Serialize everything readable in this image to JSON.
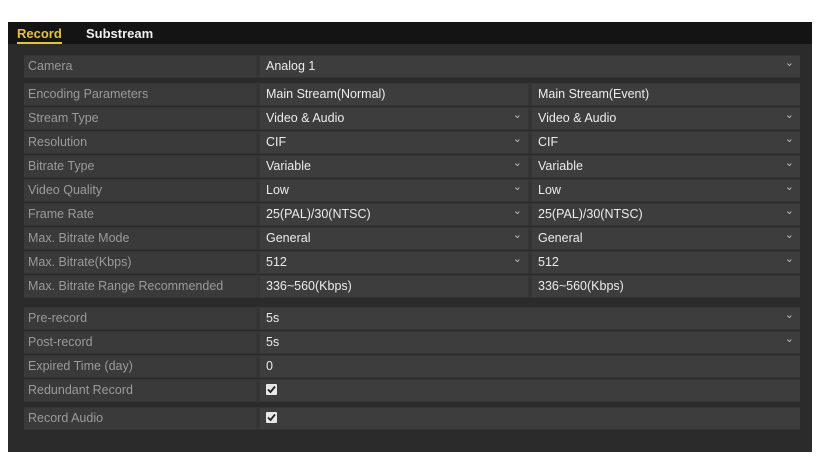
{
  "tabs": [
    {
      "label": "Record",
      "active": true
    },
    {
      "label": "Substream",
      "active": false
    }
  ],
  "camera": {
    "label": "Camera",
    "value": "Analog 1"
  },
  "encoding": {
    "label": "Encoding Parameters",
    "main_normal": "Main Stream(Normal)",
    "main_event": "Main Stream(Event)"
  },
  "stream_type": {
    "label": "Stream Type",
    "normal": "Video & Audio",
    "event": "Video & Audio"
  },
  "resolution": {
    "label": "Resolution",
    "normal": "CIF",
    "event": "CIF"
  },
  "bitrate_type": {
    "label": "Bitrate Type",
    "normal": "Variable",
    "event": "Variable"
  },
  "video_quality": {
    "label": "Video Quality",
    "normal": "Low",
    "event": "Low"
  },
  "frame_rate": {
    "label": "Frame Rate",
    "normal": "25(PAL)/30(NTSC)",
    "event": "25(PAL)/30(NTSC)"
  },
  "max_bitrate_mode": {
    "label": "Max. Bitrate Mode",
    "normal": "General",
    "event": "General"
  },
  "max_bitrate": {
    "label": "Max. Bitrate(Kbps)",
    "normal": "512",
    "event": "512"
  },
  "max_bitrate_range": {
    "label": "Max. Bitrate Range Recommended",
    "normal": "336~560(Kbps)",
    "event": "336~560(Kbps)"
  },
  "pre_record": {
    "label": "Pre-record",
    "value": "5s"
  },
  "post_record": {
    "label": "Post-record",
    "value": "5s"
  },
  "expired_time": {
    "label": "Expired Time (day)",
    "value": "0"
  },
  "redundant_record": {
    "label": "Redundant Record",
    "checked": true
  },
  "record_audio": {
    "label": "Record Audio",
    "checked": true
  },
  "colors": {
    "accent": "#e8c23a",
    "panel": "#2b2b2b",
    "label_text": "#9a9a9a",
    "value_text": "#ececec"
  },
  "icons": {
    "dropdown": "chevron-down-icon",
    "checkbox": "checkmark-icon"
  }
}
